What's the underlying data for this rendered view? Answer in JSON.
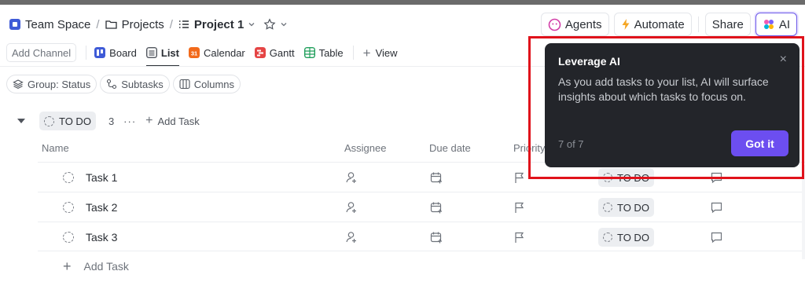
{
  "breadcrumb": {
    "space": "Team Space",
    "separator": "/",
    "folder": "Projects",
    "list": "Project 1"
  },
  "header_actions": {
    "agents": "Agents",
    "automate": "Automate",
    "share": "Share",
    "ai": "AI"
  },
  "views": {
    "add_channel": "Add Channel",
    "tabs": [
      {
        "label": "Board",
        "icon": "board-icon",
        "color": "#3f5bd7"
      },
      {
        "label": "List",
        "icon": "list-icon",
        "color": "#6e737b"
      },
      {
        "label": "Calendar",
        "icon": "calendar-icon",
        "color": "#f26a1b"
      },
      {
        "label": "Gantt",
        "icon": "gantt-icon",
        "color": "#e54545"
      },
      {
        "label": "Table",
        "icon": "table-icon",
        "color": "#1e9e5a"
      }
    ],
    "active": "List",
    "add_view": "View"
  },
  "filters": {
    "group": "Group: Status",
    "subtasks": "Subtasks",
    "columns": "Columns"
  },
  "group": {
    "status": "TO DO",
    "count": "3",
    "more": "···",
    "add_task": "Add Task"
  },
  "table": {
    "columns": [
      "Name",
      "Assignee",
      "Due date",
      "Priority"
    ],
    "rows": [
      {
        "name": "Task 1",
        "status": "TO DO"
      },
      {
        "name": "Task 2",
        "status": "TO DO"
      },
      {
        "name": "Task 3",
        "status": "TO DO"
      }
    ],
    "add_task": "Add Task"
  },
  "tooltip": {
    "title": "Leverage AI",
    "close": "×",
    "body": "As you add tasks to your list, AI will surface insights about which tasks to focus on.",
    "step": "7 of 7",
    "button": "Got it"
  },
  "colors": {
    "accent": "#6c4ef0",
    "highlight": "#e0121b",
    "tooltip_bg": "#23252a"
  }
}
